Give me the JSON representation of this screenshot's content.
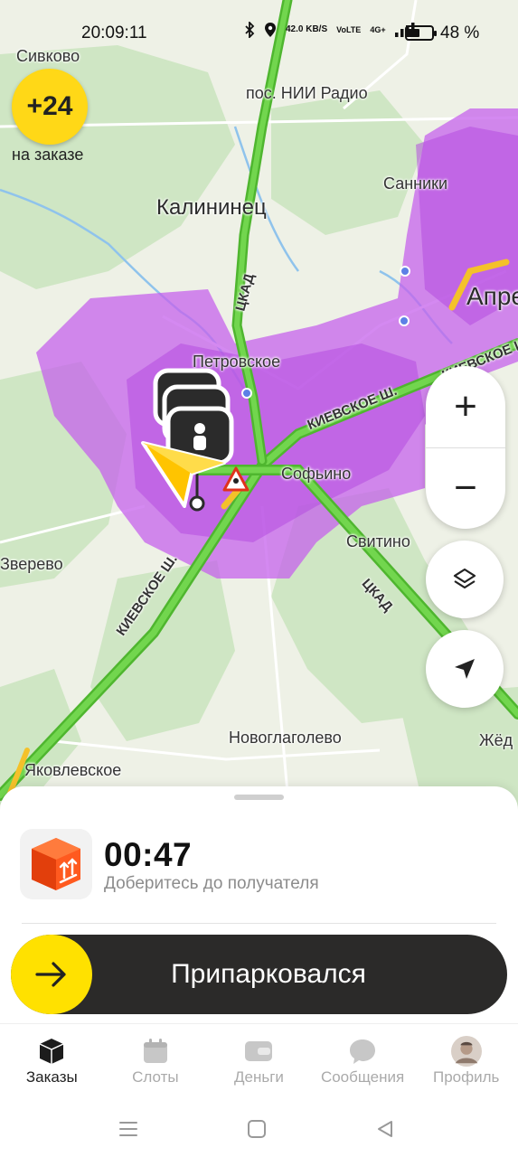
{
  "status_bar": {
    "time": "20:09:11",
    "network_speed": "42.0 KB/S",
    "volte": "VoLTE",
    "signal_gen": "4G+",
    "battery_percent": "48 %",
    "battery_level": 0.48
  },
  "rating_badge": {
    "value": "+24",
    "label": "на заказе"
  },
  "map": {
    "labels": {
      "sivkovo": "Сивково",
      "nii_radio": "пос. НИИ Радио",
      "sanniki": "Санники",
      "kalininets": "Калининец",
      "aprelevka": "Апре",
      "petrovskoe": "Петровское",
      "sofyino": "Софьино",
      "svitino": "Свитино",
      "zverevo": "Зверево",
      "novoglagolevo": "Новоглаголево",
      "zhedochi": "Жёд",
      "yakovlevskoe": "Яковлевское",
      "ckad_north": "ЦКАД",
      "ckad_south": "ЦКАД",
      "kievskoe_1": "КИЕВСКОЕ Ш.",
      "kievskoe_2": "КИЕВСКОЕ Ш.",
      "kievskoe_3": "КИЕВСКОЕ Ш."
    },
    "controls": {
      "zoom_in": "+",
      "zoom_out": "−"
    },
    "colors": {
      "surge_zone": "#c561ec",
      "road": "#5cc93a",
      "forest": "#cfe6c4",
      "courier_arrow": "#ffc400"
    }
  },
  "order_panel": {
    "timer": "00:47",
    "instruction": "Доберитесь до получателя",
    "action_label": "Припарковался"
  },
  "tabs": [
    {
      "label": "Заказы",
      "icon": "orders-box-icon",
      "active": true
    },
    {
      "label": "Слоты",
      "icon": "calendar-icon",
      "active": false
    },
    {
      "label": "Деньги",
      "icon": "wallet-icon",
      "active": false
    },
    {
      "label": "Сообщения",
      "icon": "chat-bubble-icon",
      "active": false
    },
    {
      "label": "Профиль",
      "icon": "avatar-icon",
      "active": false
    }
  ]
}
